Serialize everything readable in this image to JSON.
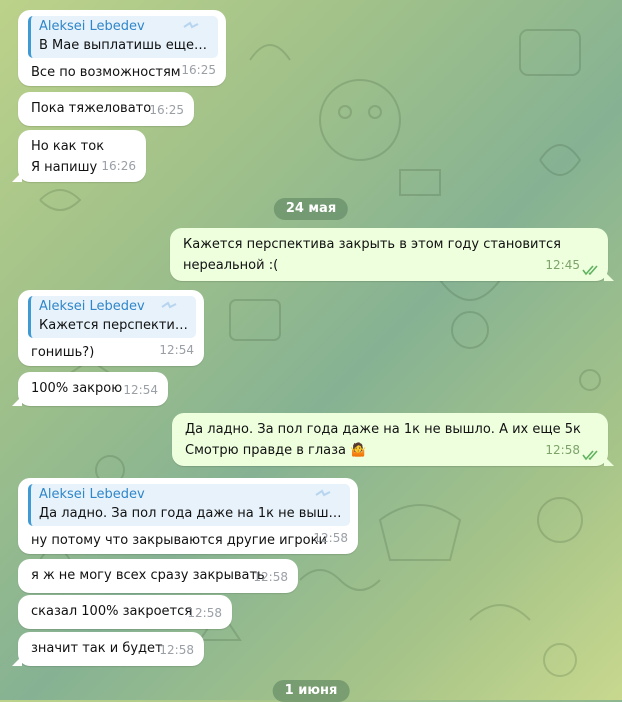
{
  "messages": [
    {
      "dir": "in",
      "reply": {
        "author": "Aleksei Lebedev",
        "text": "В Мае выплатишь еще ..."
      },
      "lines": [
        "Все по возможностям"
      ],
      "time": "16:25"
    },
    {
      "dir": "in",
      "lines": [
        "Пока тяжеловато"
      ],
      "time": "16:25"
    },
    {
      "dir": "in",
      "lines": [
        "Но как ток",
        "Я напишу"
      ],
      "time": "16:26"
    },
    {
      "dir": "out",
      "lines": [
        "Кажется перспектива закрыть в этом году становится",
        "нереальной :("
      ],
      "time": "12:45"
    },
    {
      "dir": "in",
      "reply": {
        "author": "Aleksei Lebedev",
        "text": "Кажется перспектив..."
      },
      "lines": [
        "гонишь?)"
      ],
      "time": "12:54"
    },
    {
      "dir": "in",
      "lines": [
        "100% закрою"
      ],
      "time": "12:54"
    },
    {
      "dir": "out",
      "lines": [
        "Да ладно. За пол года даже на 1к не вышло. А их еще 5к",
        "Смотрю правде в глаза 🤷"
      ],
      "time": "12:58"
    },
    {
      "dir": "in",
      "reply": {
        "author": "Aleksei Lebedev",
        "text": "Да ладно. За пол года даже на 1к не вышло. ..."
      },
      "lines": [
        "ну потому что закрываются другие игроки"
      ],
      "time": "12:58"
    },
    {
      "dir": "in",
      "lines": [
        "я ж не могу всех сразу закрывать"
      ],
      "time": "12:58"
    },
    {
      "dir": "in",
      "lines": [
        "сказал 100% закроется"
      ],
      "time": "12:58"
    },
    {
      "dir": "in",
      "lines": [
        "значит так и будет"
      ],
      "time": "12:58"
    }
  ],
  "dates": [
    "24 мая",
    "1 июня"
  ],
  "icons": {
    "read_receipt": "double-check-icon"
  },
  "colors": {
    "incoming_bubble": "#ffffff",
    "outgoing_bubble": "#eeffde",
    "reply_author": "#2f86c9",
    "checks": "#5fb35f"
  }
}
